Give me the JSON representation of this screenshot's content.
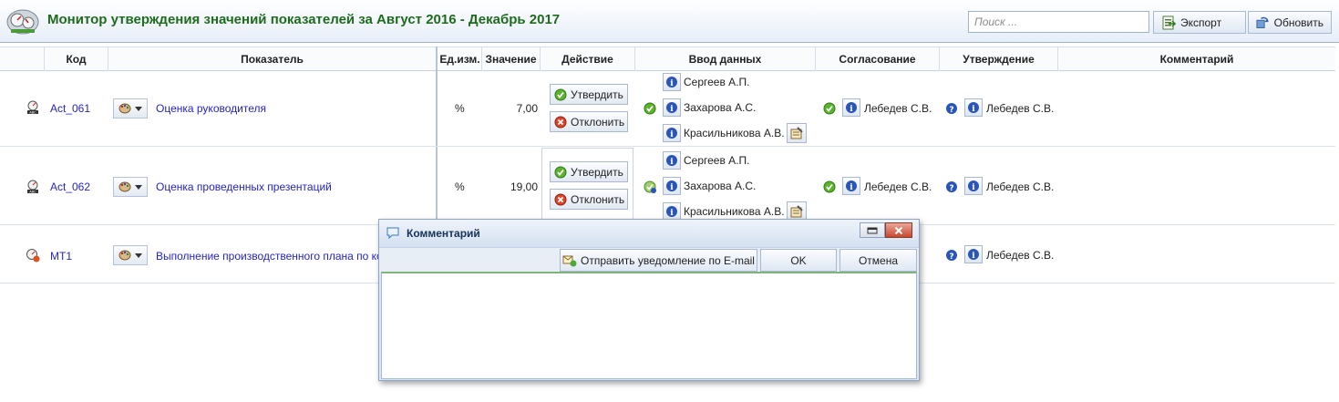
{
  "header": {
    "title": "Монитор утверждения значений показателей за Август 2016  - Декабрь 2017",
    "search_placeholder": "Поиск ...",
    "export_label": "Экспорт",
    "refresh_label": "Обновить"
  },
  "columns": {
    "code": "Код",
    "indicator": "Показатель",
    "unit": "Ед.изм.",
    "value": "Значение",
    "action": "Действие",
    "data_entry": "Ввод данных",
    "agreement": "Согласование",
    "approval": "Утверждение",
    "comment": "Комментарий"
  },
  "actions": {
    "approve": "Утвердить",
    "reject": "Отклонить"
  },
  "rows": [
    {
      "code": "Act_061",
      "indicator": "Оценка руководителя",
      "unit": "%",
      "value": "7,00",
      "entry": [
        "Сергеев А.П.",
        "Захарова А.С.",
        "Красильникова А.В."
      ],
      "agreement": "Лебедев С.В.",
      "approval": "Лебедев С.В."
    },
    {
      "code": "Act_062",
      "indicator": "Оценка проведенных презентаций",
      "unit": "%",
      "value": "19,00",
      "entry": [
        "Сергеев А.П.",
        "Захарова А.С.",
        "Красильникова А.В."
      ],
      "agreement": "Лебедев С.В.",
      "approval": "Лебедев С.В."
    },
    {
      "code": "МТ1",
      "indicator": "Выполнение производственного плана по ко",
      "approval": "Лебедев С.В."
    }
  ],
  "dialog": {
    "title": "Комментарий",
    "send_email_label": "Отправить уведомление по E-mail",
    "ok_label": "OK",
    "cancel_label": "Отмена",
    "text": ""
  },
  "colors": {
    "title_green": "#1e6b1e",
    "link_blue": "#2424c6",
    "info_blue": "#2a55b8"
  }
}
